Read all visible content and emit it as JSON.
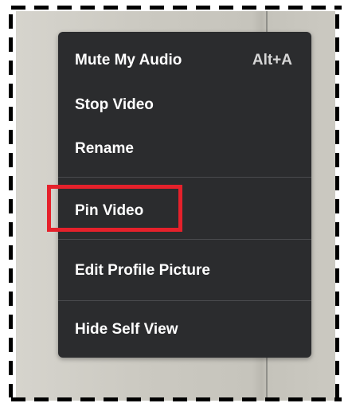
{
  "context_menu": {
    "items": [
      {
        "label": "Mute My Audio",
        "shortcut": "Alt+A"
      },
      {
        "label": "Stop Video"
      },
      {
        "label": "Rename"
      },
      {
        "label": "Pin Video"
      },
      {
        "label": "Edit Profile Picture"
      },
      {
        "label": "Hide Self View"
      }
    ],
    "highlighted_item": "Pin Video"
  },
  "colors": {
    "menu_background": "#2b2c2e",
    "menu_text": "#ffffff",
    "highlight_border": "#e5212b",
    "frame_dash": "#000000"
  }
}
